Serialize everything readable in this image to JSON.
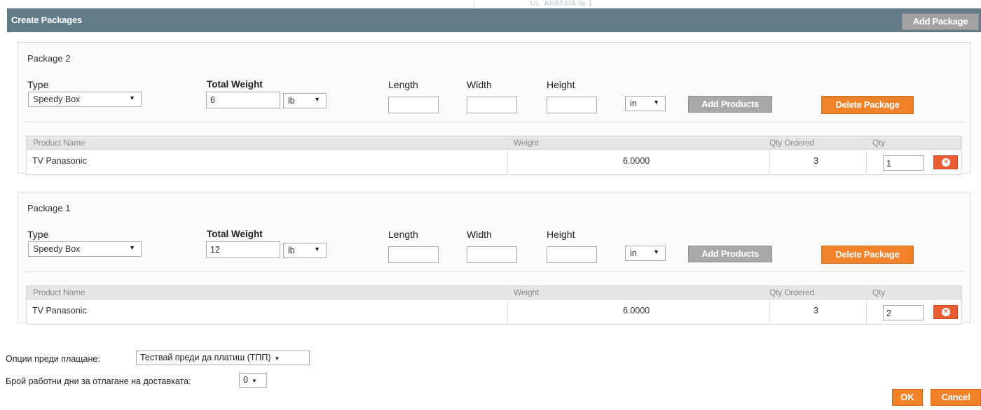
{
  "header": {
    "title": "Create Packages",
    "background_text": "UL. ARATSIA № 1",
    "add_package_label": "Add Package"
  },
  "colors": {
    "header_bg": "#617c86",
    "gray_button": "#a8a8a8",
    "orange_button": "#f1822a",
    "delete_row_button": "#eb5d32"
  },
  "packages": [
    {
      "title": "Package 2",
      "type_label": "Type",
      "type_value": "Speedy Box",
      "weight_label": "Total Weight",
      "weight_value": "6",
      "weight_unit": "lb",
      "length_label": "Length",
      "length_value": "",
      "width_label": "Width",
      "width_value": "",
      "height_label": "Height",
      "height_value": "",
      "dim_unit": "in",
      "add_products_label": "Add Products",
      "delete_package_label": "Delete Package",
      "columns": [
        "Product Name",
        "Weight",
        "Qty Ordered",
        "Qty"
      ],
      "rows": [
        {
          "product_name": "TV Panasonic",
          "weight": "6.0000",
          "qty_ordered": "3",
          "qty": "1"
        }
      ]
    },
    {
      "title": "Package 1",
      "type_label": "Type",
      "type_value": "Speedy Box",
      "weight_label": "Total Weight",
      "weight_value": "12",
      "weight_unit": "lb",
      "length_label": "Length",
      "length_value": "",
      "width_label": "Width",
      "width_value": "",
      "height_label": "Height",
      "height_value": "",
      "dim_unit": "in",
      "add_products_label": "Add Products",
      "delete_package_label": "Delete Package",
      "columns": [
        "Product Name",
        "Weight",
        "Qty Ordered",
        "Qty"
      ],
      "rows": [
        {
          "product_name": "TV Panasonic",
          "weight": "6.0000",
          "qty_ordered": "3",
          "qty": "2"
        }
      ]
    }
  ],
  "options": {
    "payment_label": "Опции преди плащане:",
    "payment_value": "Тествай преди да платиш (ТПП)",
    "delay_label": "Брой работни дни за отлагане на доставката:",
    "delay_value": "0"
  },
  "footer": {
    "ok_label": "OK",
    "cancel_label": "Cancel"
  },
  "icons": {
    "dropdown": "chevron-down-icon",
    "remove_row": "close-circle-icon"
  }
}
